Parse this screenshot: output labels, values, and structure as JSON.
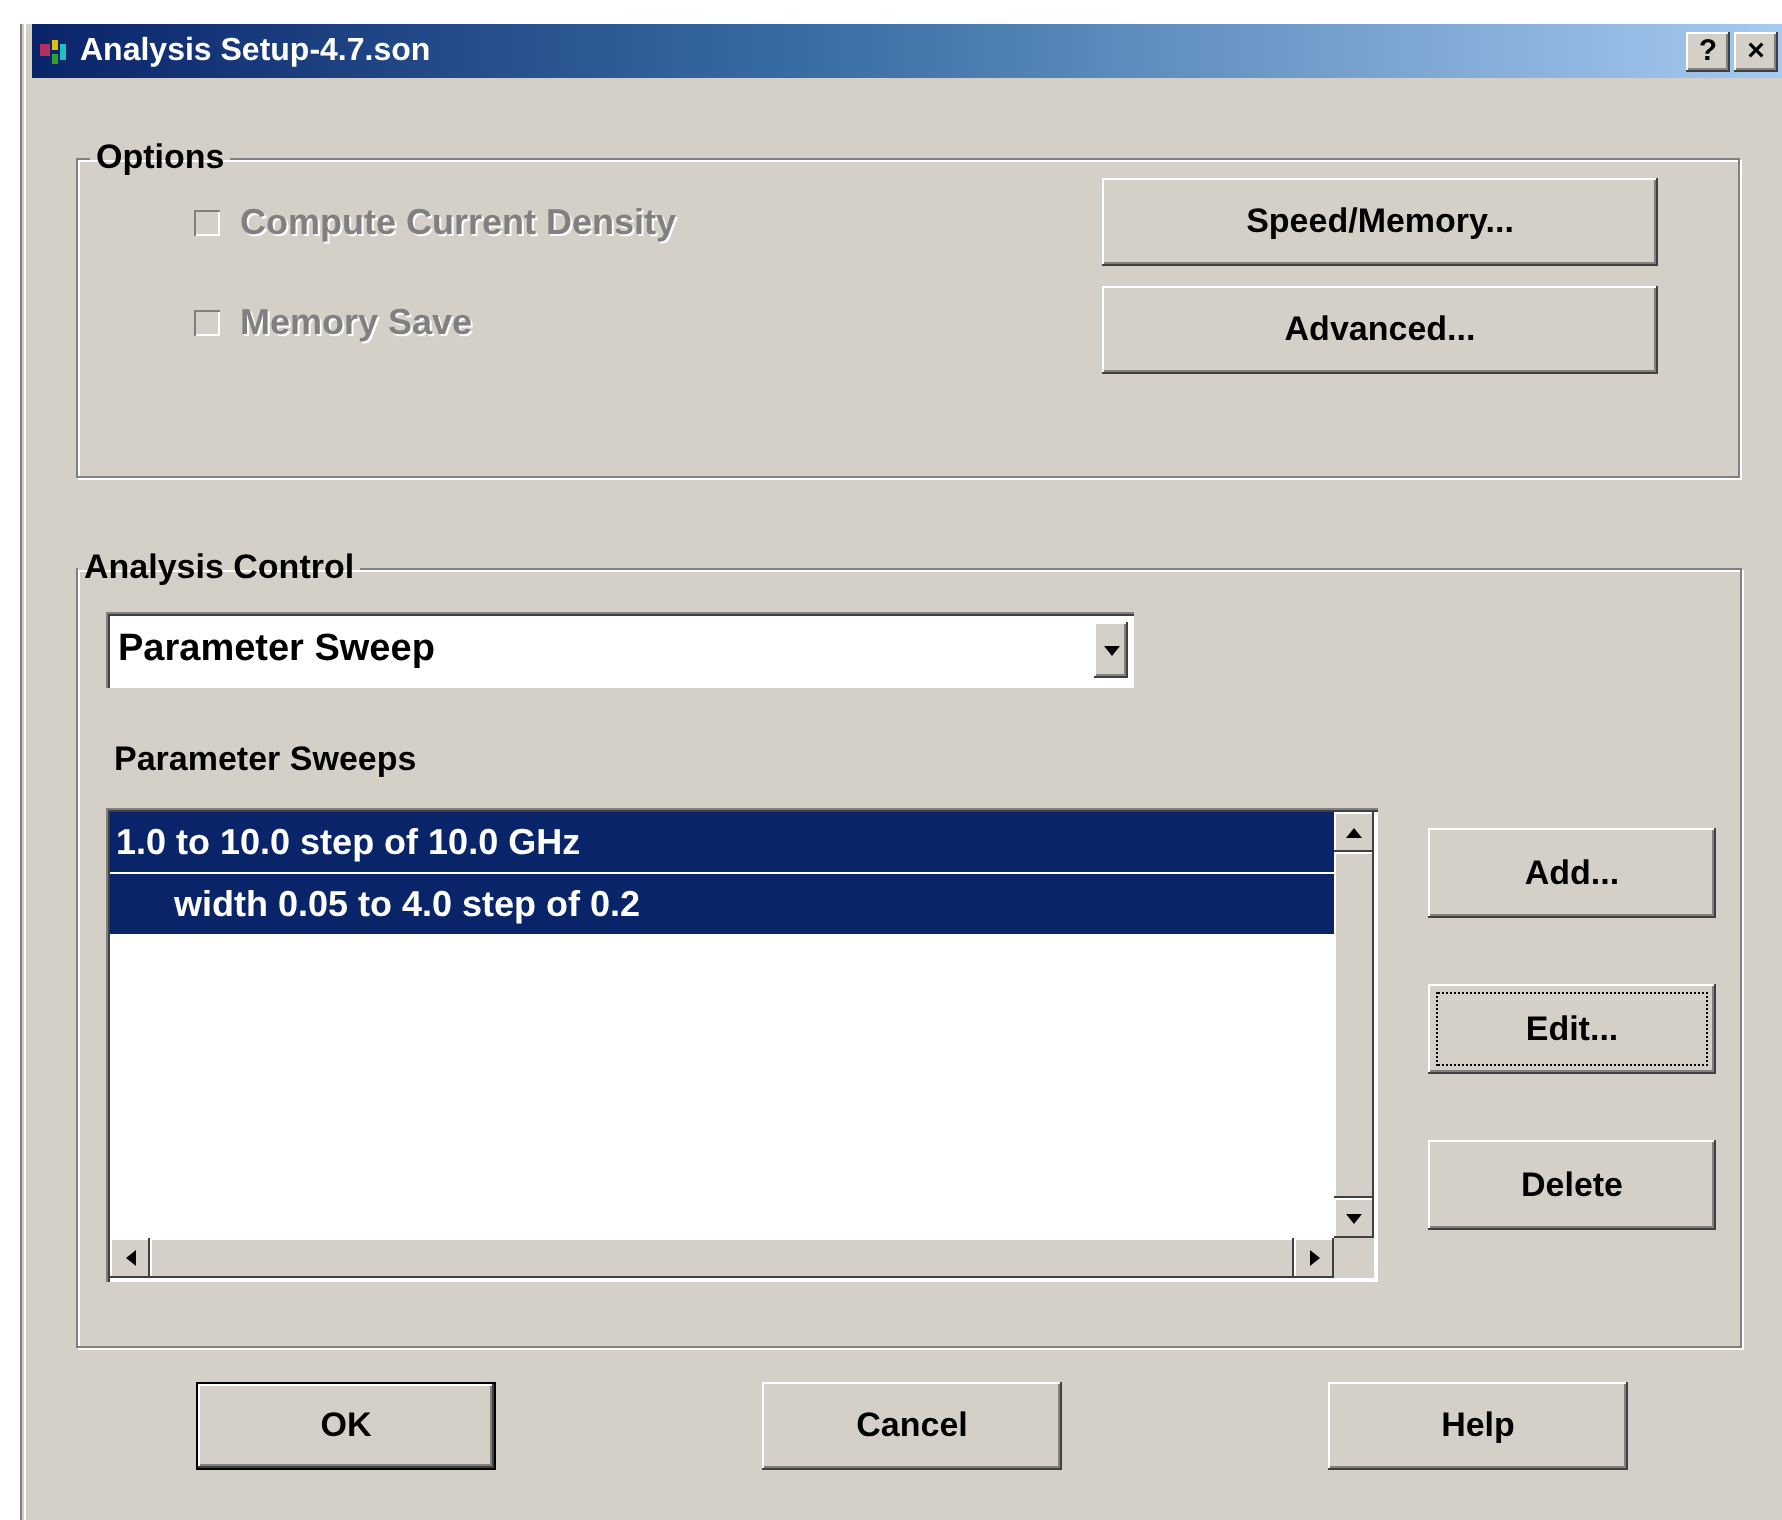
{
  "window": {
    "title": "Analysis Setup-4.7.son",
    "help_button": "?",
    "close_button": "×"
  },
  "options": {
    "title": "Options",
    "checkboxes": [
      {
        "label": "Compute Current Density",
        "checked": false,
        "disabled": true
      },
      {
        "label": "Memory Save",
        "checked": false,
        "disabled": true
      }
    ],
    "buttons": [
      {
        "label": "Speed/Memory..."
      },
      {
        "label": "Advanced..."
      }
    ]
  },
  "analysis_control": {
    "title": "Analysis Control",
    "mode": {
      "value": "Parameter Sweep"
    },
    "sweeps_label": "Parameter Sweeps",
    "sweeps": [
      {
        "text": "1.0 to 10.0 step of 10.0 GHz",
        "selected": true,
        "children": [
          {
            "text": "width 0.05 to 4.0 step of 0.2",
            "selected": true
          }
        ]
      }
    ],
    "buttons": [
      {
        "label": "Add...",
        "focused": false
      },
      {
        "label": "Edit...",
        "focused": true
      },
      {
        "label": "Delete",
        "focused": false
      }
    ]
  },
  "footer_buttons": [
    {
      "label": "OK",
      "default": true
    },
    {
      "label": "Cancel",
      "default": false
    },
    {
      "label": "Help",
      "default": false
    }
  ]
}
